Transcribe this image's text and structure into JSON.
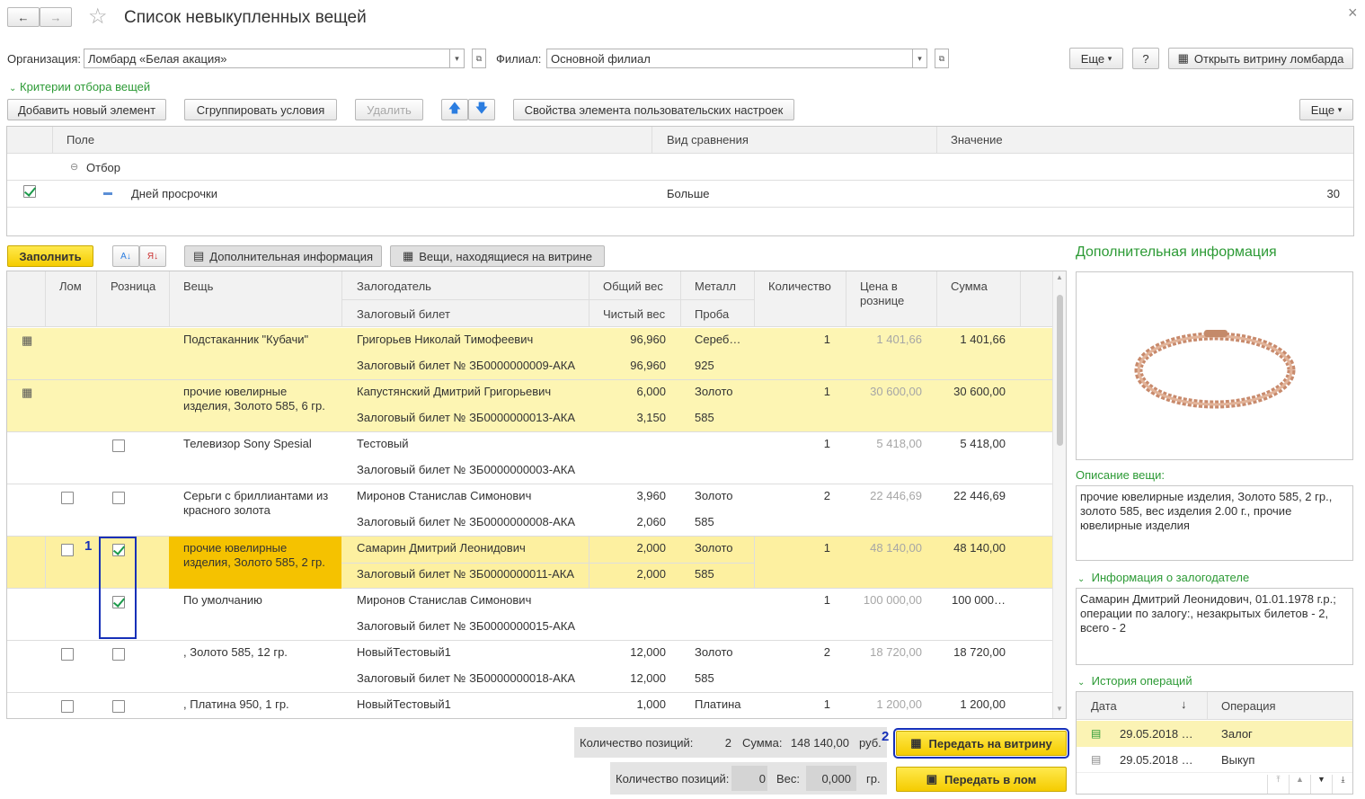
{
  "window": {
    "title": "Список невыкупленных вещей",
    "close": "×"
  },
  "nav": {
    "back": "←",
    "forward": "→",
    "star": "☆"
  },
  "filters": {
    "org_label": "Организация:",
    "org_value": "Ломбард «Белая акация»",
    "branch_label": "Филиал:",
    "branch_value": "Основной филиал"
  },
  "topbar": {
    "more": "Еще",
    "help": "?",
    "open_showcase": "Открыть витрину ломбарда"
  },
  "criteria": {
    "title": "Критерии отбора вещей",
    "add": "Добавить новый элемент",
    "group": "Сгруппировать условия",
    "delete": "Удалить",
    "props": "Свойства элемента пользовательских настроек",
    "more": "Еще",
    "cols": {
      "field": "Поле",
      "comparison": "Вид сравнения",
      "value": "Значение"
    },
    "group_row": "Отбор",
    "row": {
      "field": "Дней просрочки",
      "comparison": "Больше",
      "value": "30"
    }
  },
  "toolbar2": {
    "fill": "Заполнить",
    "extra_info": "Дополнительная информация",
    "on_showcase": "Вещи, находящиеся на витрине"
  },
  "table": {
    "headers": {
      "scrap": "Лом",
      "retail": "Розница",
      "item": "Вещь",
      "pawner": "Залогодатель",
      "ticket": "Залоговый билет",
      "gross": "Общий вес",
      "net": "Чистый вес",
      "metal": "Металл",
      "fineness": "Проба",
      "qty": "Количество",
      "retail_price": "Цена в рознице",
      "sum": "Сумма"
    },
    "rows": [
      {
        "item": "Подстаканник \"Кубачи\"",
        "pawner": "Григорьев Николай Тимофеевич",
        "ticket": "Залоговый билет № ЗБ0000000009-АКА",
        "gross": "96,960",
        "net": "96,960",
        "metal": "Сереб…",
        "fineness": "925",
        "qty": "1",
        "price": "1 401,66",
        "sum": "1 401,66"
      },
      {
        "item": "прочие ювелирные изделия, Золото 585, 6 гр.",
        "pawner": "Капустянский Дмитрий Григорьевич",
        "ticket": "Залоговый билет № ЗБ0000000013-АКА",
        "gross": "6,000",
        "net": "3,150",
        "metal": "Золото",
        "fineness": "585",
        "qty": "1",
        "price": "30 600,00",
        "sum": "30 600,00"
      },
      {
        "item": "Телевизор Sony Spesial",
        "pawner": "Тестовый",
        "ticket": "Залоговый билет № ЗБ0000000003-АКА",
        "gross": "",
        "net": "",
        "metal": "",
        "fineness": "",
        "qty": "1",
        "price": "5 418,00",
        "sum": "5 418,00"
      },
      {
        "item": "Серьги с бриллиантами из красного золота",
        "pawner": "Миронов Станислав Симонович",
        "ticket": "Залоговый билет № ЗБ0000000008-АКА",
        "gross": "3,960",
        "net": "2,060",
        "metal": "Золото",
        "fineness": "585",
        "qty": "2",
        "price": "22 446,69",
        "sum": "22 446,69"
      },
      {
        "item": "прочие ювелирные изделия, Золото 585, 2 гр.",
        "pawner": "Самарин Дмитрий Леонидович",
        "ticket": "Залоговый билет № ЗБ0000000011-АКА",
        "gross": "2,000",
        "net": "2,000",
        "metal": "Золото",
        "fineness": "585",
        "qty": "1",
        "price": "48 140,00",
        "sum": "48 140,00"
      },
      {
        "item": "По умолчанию",
        "pawner": "Миронов Станислав Симонович",
        "ticket": "Залоговый билет № ЗБ0000000015-АКА",
        "gross": "",
        "net": "",
        "metal": "",
        "fineness": "",
        "qty": "1",
        "price": "100 000,00",
        "sum": "100 000…"
      },
      {
        "item": ", Золото 585, 12 гр.",
        "pawner": "НовыйТестовый1",
        "ticket": "Залоговый билет № ЗБ0000000018-АКА",
        "gross": "12,000",
        "net": "12,000",
        "metal": "Золото",
        "fineness": "585",
        "qty": "2",
        "price": "18 720,00",
        "sum": "18 720,00"
      },
      {
        "item": ", Платина 950, 1 гр.",
        "pawner": "НовыйТестовый1",
        "ticket": "",
        "gross": "1,000",
        "net": "",
        "metal": "Платина",
        "fineness": "",
        "qty": "1",
        "price": "1 200,00",
        "sum": "1 200,00"
      }
    ]
  },
  "annotations": {
    "mark1": "1",
    "mark2": "2"
  },
  "footer": {
    "count_label": "Количество позиций:",
    "count_value": "2",
    "sum_label": "Сумма:",
    "sum_value": "148 140,00",
    "currency": "руб.",
    "transfer_showcase": "Передать на витрину",
    "count2_label": "Количество позиций:",
    "count2_value": "0",
    "weight_label": "Вес:",
    "weight_value": "0,000",
    "weight_unit": "гр.",
    "transfer_scrap": "Передать в лом"
  },
  "side": {
    "title": "Дополнительная информация",
    "desc_label": "Описание вещи:",
    "desc_text": "прочие ювелирные изделия, Золото 585, 2 гр., золото 585, вес изделия 2.00 г., прочие ювелирные изделия",
    "pawner_label": "Информация о залогодателе",
    "pawner_text": "Самарин Дмитрий Леонидович, 01.01.1978 г.р.; операции по залогу:, незакрытых билетов - 2, всего - 2",
    "history_label": "История операций",
    "hist_cols": {
      "date": "Дата",
      "op": "Операция"
    },
    "history": [
      {
        "date": "29.05.2018 …",
        "op": "Залог"
      },
      {
        "date": "29.05.2018 …",
        "op": "Выкуп"
      }
    ]
  }
}
